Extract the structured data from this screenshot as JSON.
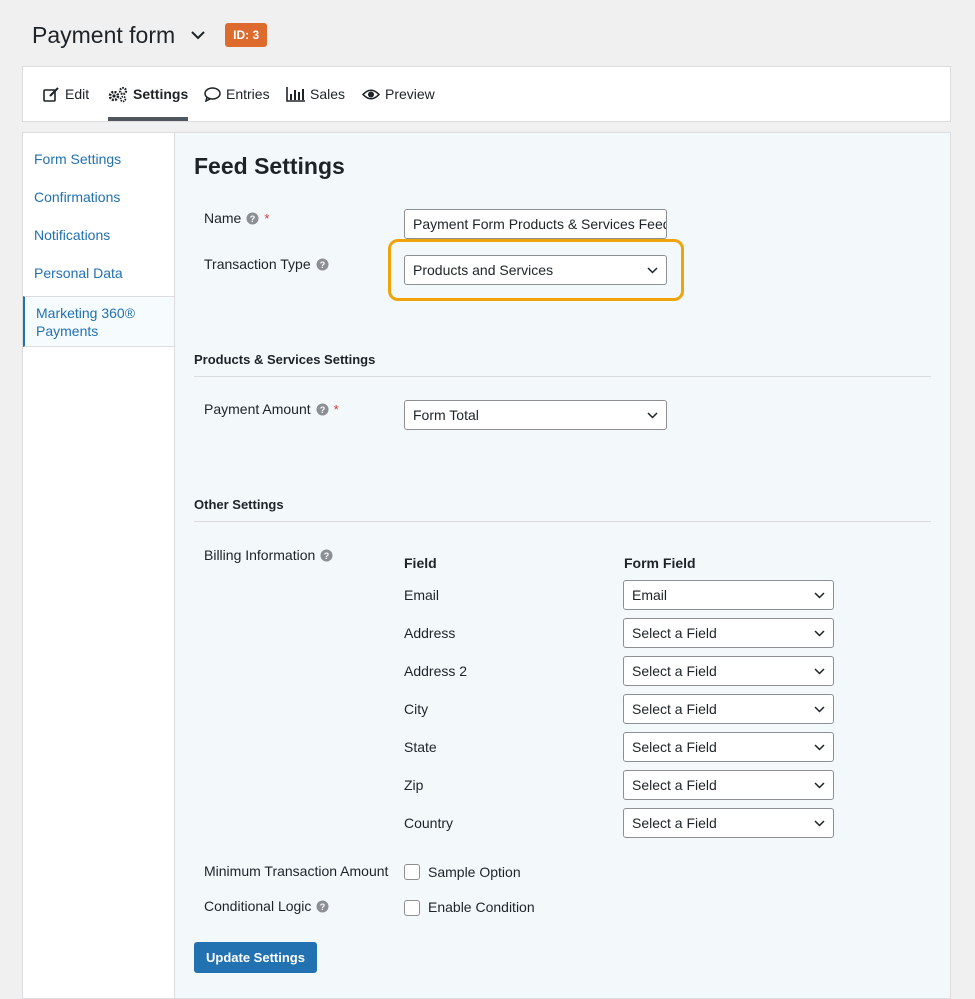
{
  "header": {
    "title": "Payment form",
    "id_badge": "ID: 3"
  },
  "tabs": [
    {
      "label": "Edit",
      "icon": "edit-icon"
    },
    {
      "label": "Settings",
      "icon": "gears-icon",
      "active": true
    },
    {
      "label": "Entries",
      "icon": "comment-icon"
    },
    {
      "label": "Sales",
      "icon": "chart-bars-icon"
    },
    {
      "label": "Preview",
      "icon": "eye-icon"
    }
  ],
  "sidebar": {
    "items": [
      {
        "label": "Form Settings"
      },
      {
        "label": "Confirmations"
      },
      {
        "label": "Notifications"
      },
      {
        "label": "Personal Data"
      },
      {
        "label": "Marketing 360®\nPayments",
        "active": true
      }
    ]
  },
  "feed": {
    "title": "Feed Settings",
    "name_label": "Name",
    "name_value": "Payment Form Products & Services Feed",
    "transaction_type_label": "Transaction Type",
    "transaction_type_value": "Products and Services"
  },
  "products_section": {
    "heading": "Products & Services Settings",
    "payment_amount_label": "Payment Amount",
    "payment_amount_value": "Form Total"
  },
  "other_section": {
    "heading": "Other Settings",
    "billing_label": "Billing Information",
    "col_field": "Field",
    "col_form_field": "Form Field",
    "rows": [
      {
        "field": "Email",
        "value": "Email"
      },
      {
        "field": "Address",
        "value": "Select a Field"
      },
      {
        "field": "Address 2",
        "value": "Select a Field"
      },
      {
        "field": "City",
        "value": "Select a Field"
      },
      {
        "field": "State",
        "value": "Select a Field"
      },
      {
        "field": "Zip",
        "value": "Select a Field"
      },
      {
        "field": "Country",
        "value": "Select a Field"
      }
    ],
    "min_amount_label": "Minimum Transaction Amount",
    "min_amount_option": "Sample Option",
    "conditional_label": "Conditional Logic",
    "conditional_option": "Enable Condition"
  },
  "update_button": "Update Settings",
  "colors": {
    "accent": "#2271b1",
    "badge": "#dd6b2e",
    "highlight": "#f0a30a",
    "required": "#d63638"
  }
}
